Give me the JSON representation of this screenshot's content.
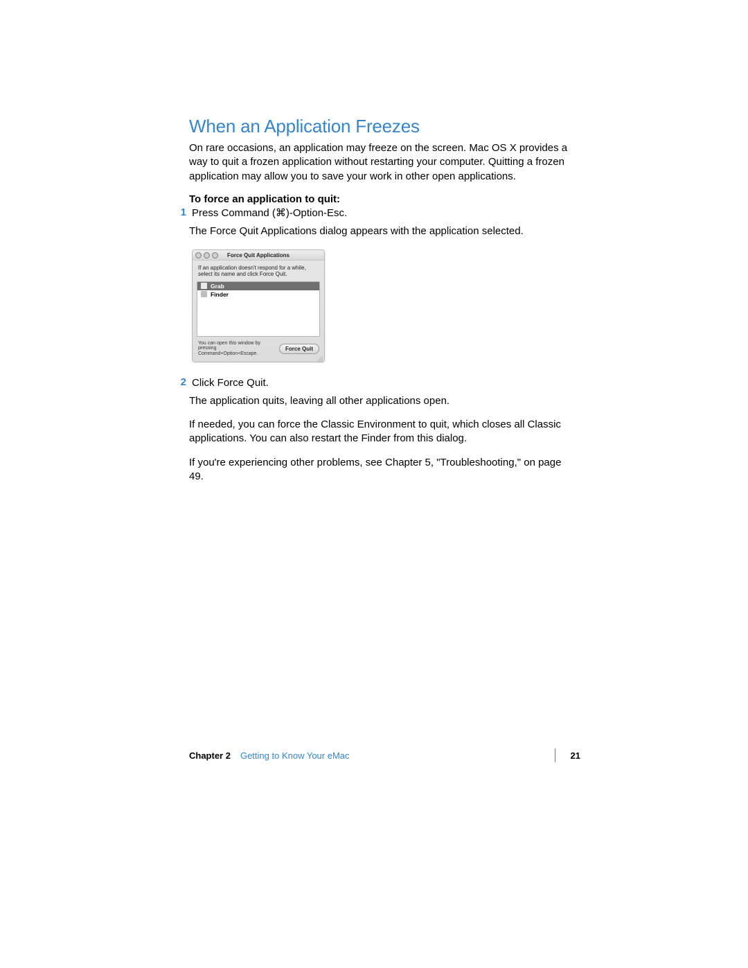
{
  "heading": "When an Application Freezes",
  "intro": "On rare occasions, an application may freeze on the screen. Mac OS X provides a way to quit a frozen application without restarting your computer. Quitting a frozen application may allow you to save your work in other open applications.",
  "sub_heading": "To force an application to quit:",
  "step1_num": "1",
  "step1_text": "Press Command (⌘)-Option-Esc.",
  "step1_para": "The Force Quit Applications dialog appears with the application selected.",
  "dialog": {
    "title": "Force Quit Applications",
    "instruction": "If an application doesn't respond for a while, select its name and click Force Quit.",
    "items": [
      {
        "name": "Grab",
        "selected": true
      },
      {
        "name": "Finder",
        "selected": false
      }
    ],
    "hint": "You can open this window by pressing Command+Option+Escape.",
    "button": "Force Quit"
  },
  "step2_num": "2",
  "step2_text": "Click Force Quit.",
  "para_after_step2_1": "The application quits, leaving all other applications open.",
  "para_after_step2_2": "If needed, you can force the Classic Environment to quit, which closes all Classic applications. You can also restart the Finder from this dialog.",
  "para_after_step2_3": "If you're experiencing other problems, see Chapter 5, \"Troubleshooting,\" on page 49.",
  "footer": {
    "chapter_label": "Chapter 2",
    "chapter_title": "Getting to Know Your eMac",
    "page_number": "21"
  }
}
